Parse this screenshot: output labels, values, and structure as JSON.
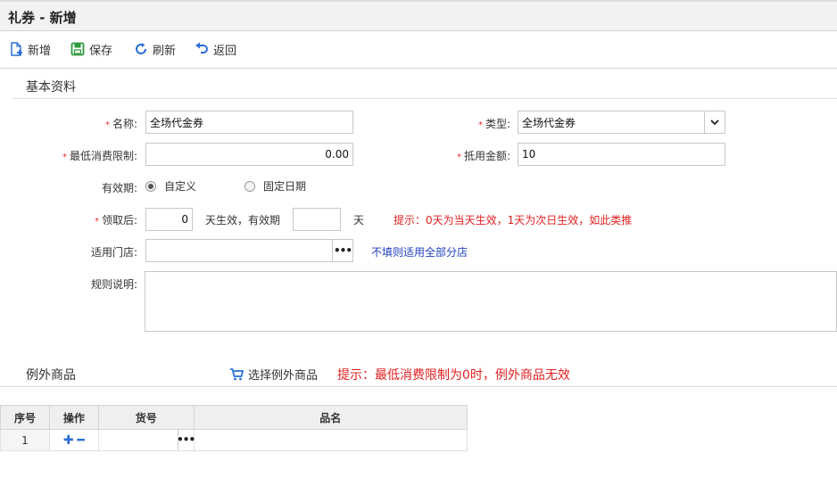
{
  "window": {
    "title": "礼券 - 新增"
  },
  "toolbar": {
    "new_label": "新增",
    "save_label": "保存",
    "refresh_label": "刷新",
    "back_label": "返回"
  },
  "basic": {
    "section_title": "基本资料",
    "name": {
      "label": "名称:",
      "value": "全场代金券"
    },
    "type": {
      "label": "类型:",
      "value": "全场代金券"
    },
    "min_limit": {
      "label": "最低消费限制:",
      "value": "0.00"
    },
    "deduct": {
      "label": "抵用金额:",
      "value": "10"
    },
    "validity": {
      "label": "有效期:",
      "option_custom": "自定义",
      "option_fixed": "固定日期",
      "selected": "自定义"
    },
    "receive": {
      "label": "领取后:",
      "days_value": "0",
      "mid_text": "天生效，有效期",
      "period_value": "",
      "unit": "天",
      "hint": "提示：0天为当天生效，1天为次日生效，如此类推"
    },
    "store": {
      "label": "适用门店:",
      "value": "",
      "hint": "不填则适用全部分店"
    },
    "rules": {
      "label": "规则说明:",
      "value": ""
    }
  },
  "exceptions": {
    "section_title": "例外商品",
    "select_label": "选择例外商品",
    "hint": "提示：最低消费限制为0时，例外商品无效"
  },
  "table": {
    "headers": [
      "序号",
      "操作",
      "货号",
      "品名"
    ],
    "rows": [
      {
        "index": "1",
        "sku": "",
        "name": ""
      }
    ]
  },
  "colors": {
    "required": "#e03030",
    "hint_red": "#e02020",
    "hint_blue": "#1e3fbf",
    "icon_blue": "#2a6fd6",
    "icon_green": "#2f9a3e"
  }
}
